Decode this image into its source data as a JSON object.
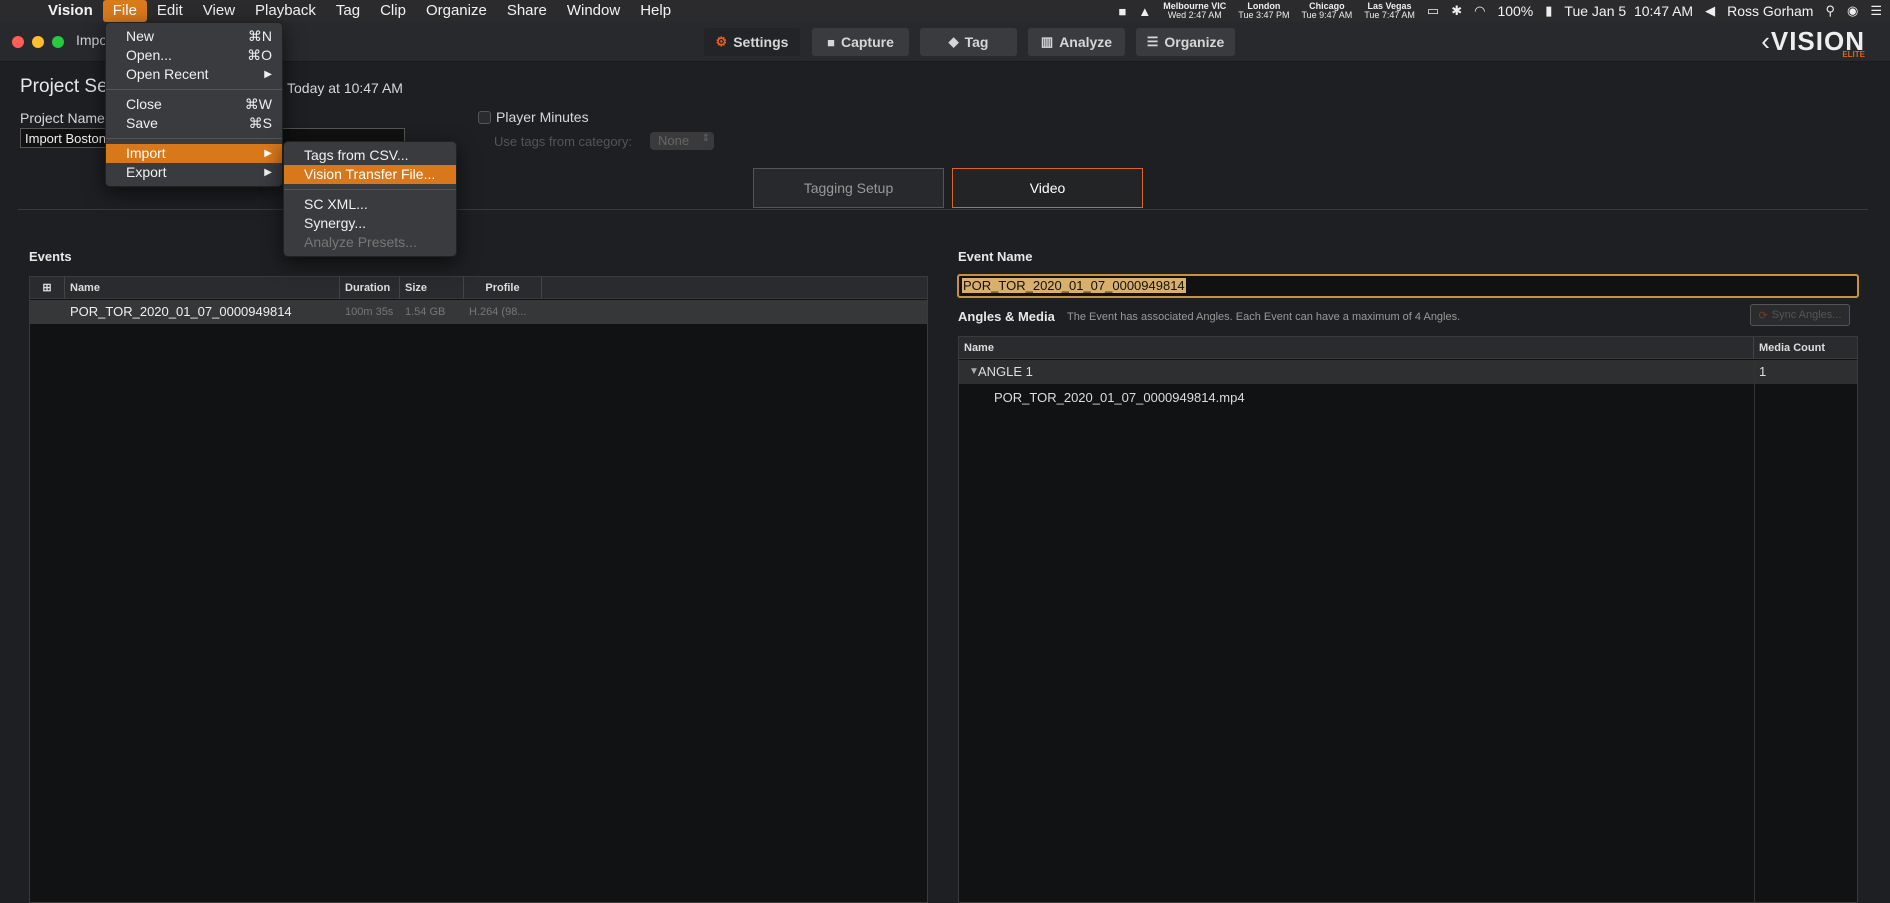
{
  "menubar": {
    "app": "Vision",
    "items": [
      "File",
      "Edit",
      "View",
      "Playback",
      "Tag",
      "Clip",
      "Organize",
      "Share",
      "Window",
      "Help"
    ],
    "clocks": [
      {
        "city": "Melbourne VIC",
        "time": "Wed 2:47 AM"
      },
      {
        "city": "London",
        "time": "Tue 3:47 PM"
      },
      {
        "city": "Chicago",
        "time": "Tue 9:47 AM"
      },
      {
        "city": "Las Vegas",
        "time": "Tue 7:47 AM"
      }
    ],
    "battery": "100%",
    "datetime": "Tue Jan 5  10:47 AM",
    "user": "Ross Gorham"
  },
  "window": {
    "title": "Impo",
    "toolbar": [
      {
        "label": "Settings",
        "icon": "gear-icon"
      },
      {
        "label": "Capture",
        "icon": "camera-icon"
      },
      {
        "label": "Tag",
        "icon": "tag-icon"
      },
      {
        "label": "Analyze",
        "icon": "chart-icon"
      },
      {
        "label": "Organize",
        "icon": "grid-icon"
      }
    ],
    "logo": "VISION",
    "logo_sub": "ELITE"
  },
  "settings": {
    "section_title": "Project Se",
    "modified": "Today at 10:47 AM",
    "project_name_label": "Project Name",
    "project_name_value": "Import Boston",
    "player_minutes_label": "Player Minutes",
    "use_tags_label": "Use tags from category:",
    "use_tags_value": "None"
  },
  "tabs": [
    "Tagging Setup",
    "Video"
  ],
  "events": {
    "title": "Events",
    "columns": [
      "Name",
      "Duration",
      "Size",
      "Profile"
    ],
    "rows": [
      {
        "name": "POR_TOR_2020_01_07_0000949814",
        "duration": "100m 35s",
        "size": "1.54 GB",
        "profile": "H.264 (98..."
      }
    ]
  },
  "event_detail": {
    "name_label": "Event Name",
    "name_value": "POR_TOR_2020_01_07_0000949814",
    "angles_label": "Angles & Media",
    "angles_desc": "The Event has associated Angles. Each Event can have a maximum of 4 Angles.",
    "sync_label": "Sync Angles...",
    "columns": [
      "Name",
      "Media Count"
    ],
    "angle": {
      "name": "ANGLE 1",
      "count": "1"
    },
    "media": "POR_TOR_2020_01_07_0000949814.mp4"
  },
  "file_menu": {
    "items": [
      {
        "label": "New",
        "shortcut": "⌘N"
      },
      {
        "label": "Open...",
        "shortcut": "⌘O"
      },
      {
        "label": "Open Recent",
        "shortcut": "▶"
      },
      {
        "label": "Close",
        "shortcut": "⌘W"
      },
      {
        "label": "Save",
        "shortcut": "⌘S"
      },
      {
        "label": "Import",
        "shortcut": "▶"
      },
      {
        "label": "Export",
        "shortcut": "▶"
      }
    ]
  },
  "import_menu": {
    "items": [
      "Tags from CSV...",
      "Vision Transfer File...",
      "SC XML...",
      "Synergy...",
      "Analyze Presets..."
    ]
  }
}
